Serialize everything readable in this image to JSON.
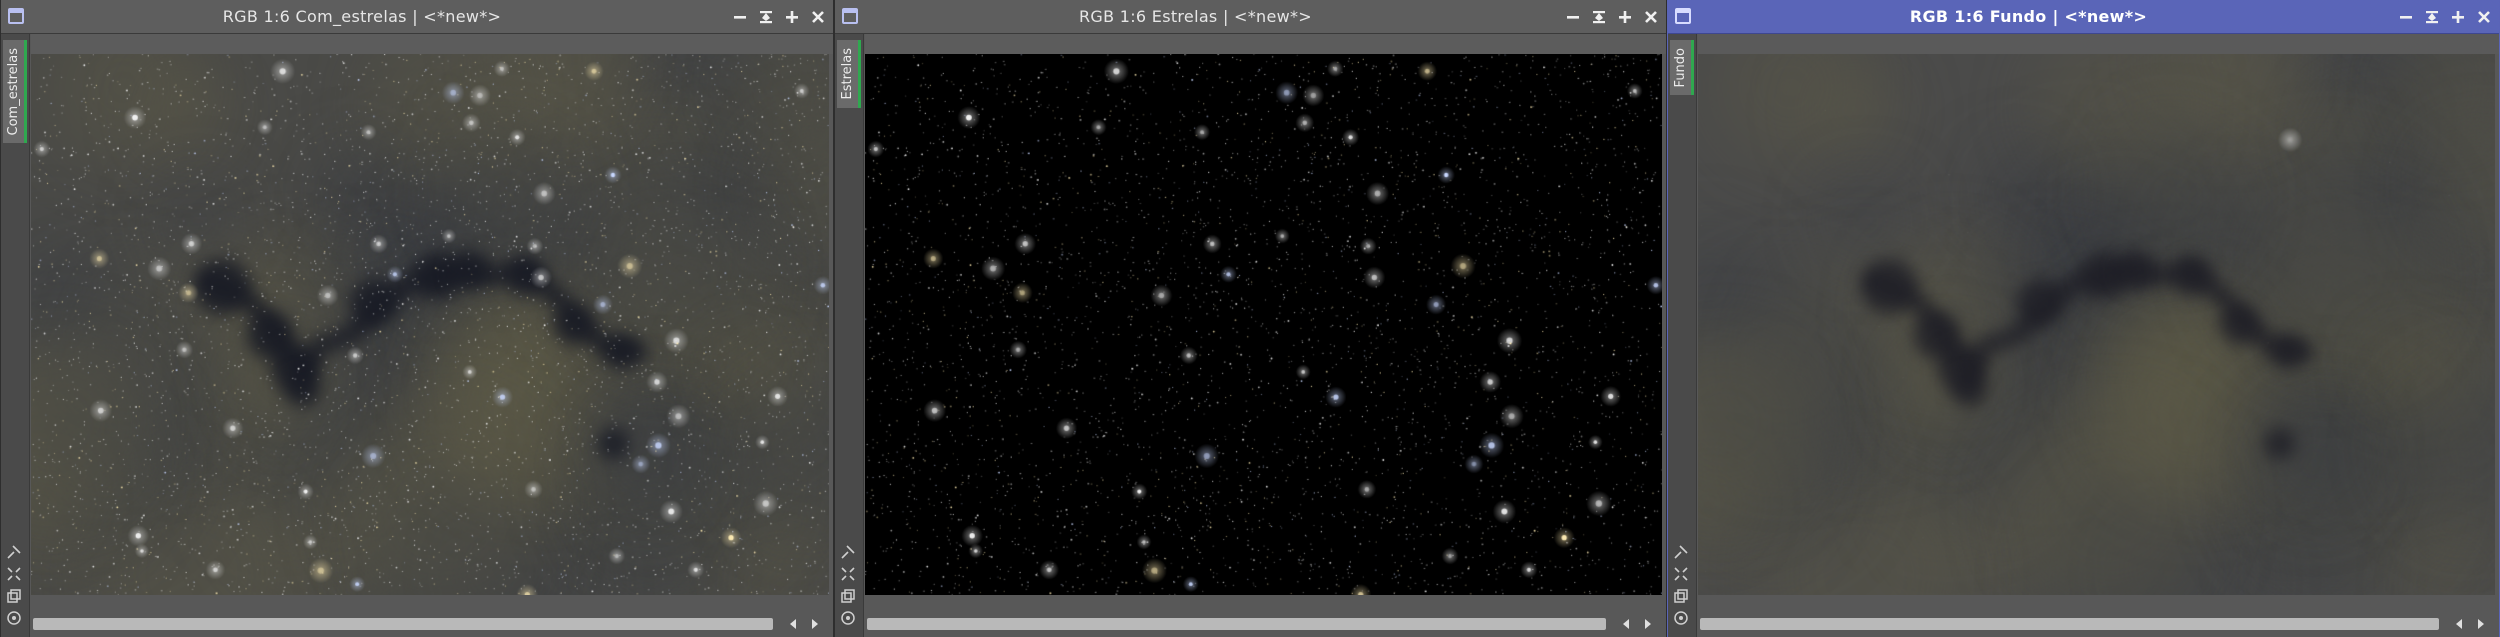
{
  "windows": [
    {
      "id": "com-estrelas",
      "title": "RGB 1:6 Com_estrelas | <*new*>",
      "tab_label": "Com_estrelas",
      "active": false,
      "image_kind": "stars_and_nebula"
    },
    {
      "id": "estrelas",
      "title": "RGB 1:6 Estrelas | <*new*>",
      "tab_label": "Estrelas",
      "active": false,
      "image_kind": "stars_only"
    },
    {
      "id": "fundo",
      "title": "RGB 1:6 Fundo | <*new*>",
      "tab_label": "Fundo",
      "active": true,
      "image_kind": "background_only"
    }
  ],
  "icons": {
    "window": "window-icon",
    "minimize": "minimize-icon",
    "shade": "shade-icon",
    "maximize": "maximize-icon",
    "close": "close-icon",
    "tools": [
      "pin-icon",
      "fit-icon",
      "clone-icon",
      "preview-icon"
    ],
    "scroll_left": "chevron-left-icon",
    "scroll_right": "chevron-right-icon"
  },
  "colors": {
    "active_titlebar": "#5a65b8",
    "inactive_titlebar": "#5e5e5e",
    "tab_accent": "#2fa84f"
  }
}
